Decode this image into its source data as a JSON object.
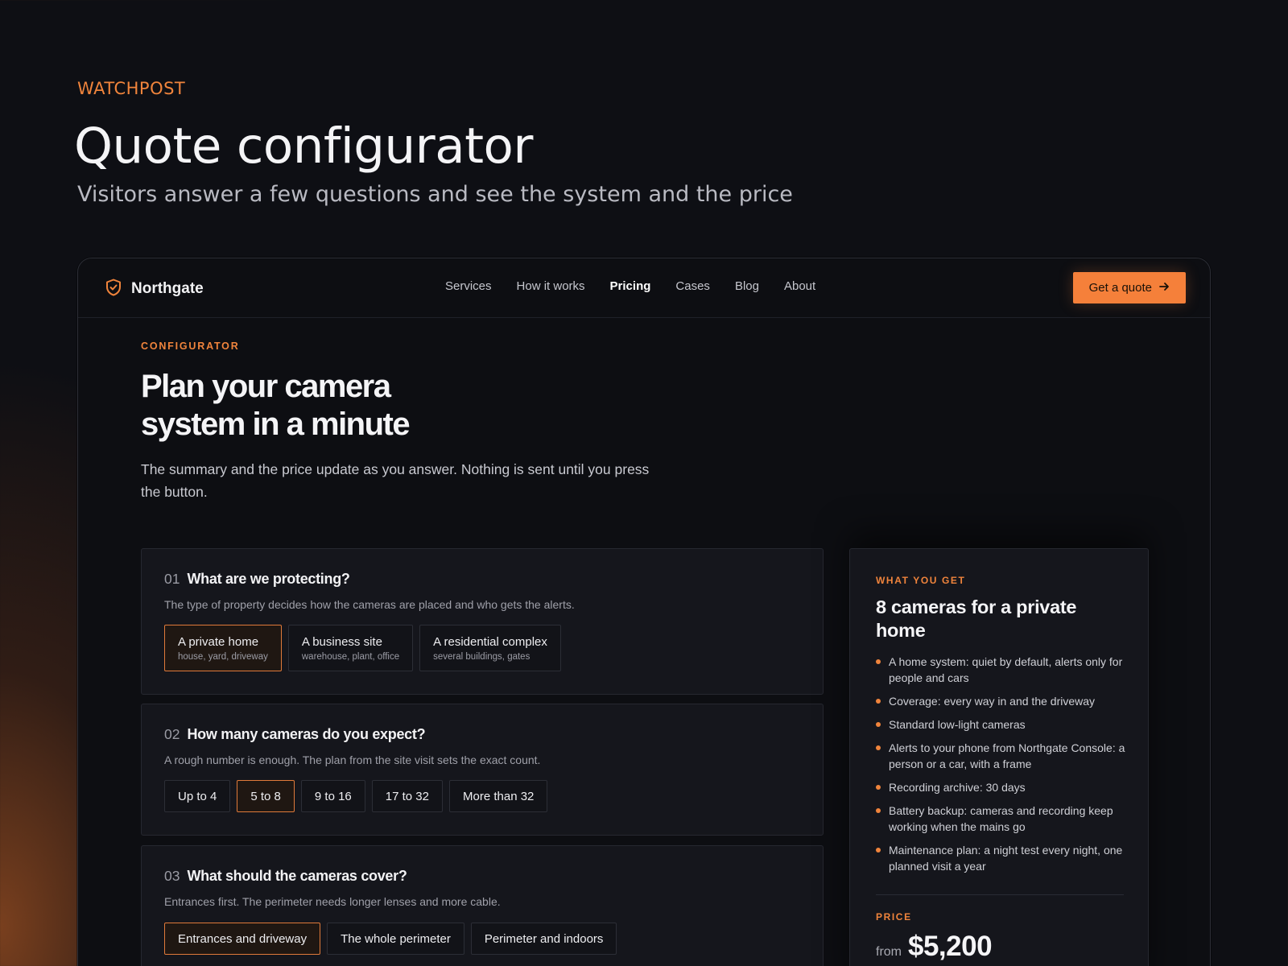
{
  "header": {
    "eyebrow": "WATCHPOST",
    "title": "Quote configurator",
    "subtitle": "Visitors answer a few questions and see the system and the price"
  },
  "nav": {
    "brand": "Northgate",
    "brand_icon": "shield-check-icon",
    "links": [
      "Services",
      "How it works",
      "Pricing",
      "Cases",
      "Blog",
      "About"
    ],
    "active": "Pricing",
    "cta": "Get a quote",
    "cta_icon": "arrow-right-icon"
  },
  "hero": {
    "kicker": "CONFIGURATOR",
    "title_line1": "Plan your camera",
    "title_line2": "system in a minute",
    "description": "The summary and the price update as you answer. Nothing is sent until you press the button."
  },
  "questions": [
    {
      "num": "01",
      "title": "What are we protecting?",
      "hint": "The type of property decides how the cameras are placed and who gets the alerts.",
      "options": [
        {
          "label": "A private home",
          "sub": "house, yard, driveway",
          "selected": true
        },
        {
          "label": "A business site",
          "sub": "warehouse, plant, office",
          "selected": false
        },
        {
          "label": "A residential complex",
          "sub": "several buildings, gates",
          "selected": false
        }
      ]
    },
    {
      "num": "02",
      "title": "How many cameras do you expect?",
      "hint": "A rough number is enough. The plan from the site visit sets the exact count.",
      "options": [
        {
          "label": "Up to 4",
          "selected": false
        },
        {
          "label": "5 to 8",
          "selected": true
        },
        {
          "label": "9 to 16",
          "selected": false
        },
        {
          "label": "17 to 32",
          "selected": false
        },
        {
          "label": "More than 32",
          "selected": false
        }
      ]
    },
    {
      "num": "03",
      "title": "What should the cameras cover?",
      "hint": "Entrances first. The perimeter needs longer lenses and more cable.",
      "options": [
        {
          "label": "Entrances and driveway",
          "selected": true
        },
        {
          "label": "The whole perimeter",
          "selected": false
        },
        {
          "label": "Perimeter and indoors",
          "selected": false
        }
      ]
    }
  ],
  "summary": {
    "kicker": "WHAT YOU GET",
    "title": "8 cameras for a private home",
    "items": [
      "A home system: quiet by default, alerts only for people and cars",
      "Coverage: every way in and the driveway",
      "Standard low-light cameras",
      "Alerts to your phone from Northgate Console: a person or a car, with a frame",
      "Recording archive: 30 days",
      "Battery backup: cameras and recording keep working when the mains go",
      "Maintenance plan: a night test every night, one planned visit a year"
    ],
    "price_kicker": "PRICE",
    "price_from": "from",
    "price": "$5,200"
  },
  "colors": {
    "accent": "#f0843c",
    "background": "#0e0f14",
    "card": "#15161c"
  }
}
